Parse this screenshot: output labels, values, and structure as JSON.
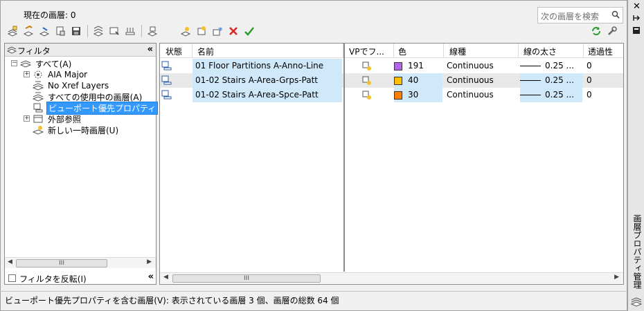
{
  "current_layer_label": "現在の画層: 0",
  "search": {
    "placeholder": "次の画層を検索"
  },
  "filter_panel": {
    "header": "フィルタ",
    "tree": [
      {
        "label": "すべて(A)"
      },
      {
        "label": "AIA Major"
      },
      {
        "label": "No Xref Layers"
      },
      {
        "label": "すべての使用中の画層(A)"
      },
      {
        "label": "ビューポート優先プロパティ"
      },
      {
        "label": "外部参照"
      },
      {
        "label": "新しい一時画層(U)"
      }
    ],
    "invert_filter": "フィルタを反転(I)",
    "collapse": "«",
    "scroll_thumb": "III"
  },
  "columns": {
    "status": "状態",
    "name": "名前",
    "vp_freeze": "VPでフ...",
    "color": "色",
    "linetype": "線種",
    "lineweight": "線の太さ",
    "transparency": "透過性"
  },
  "layers": [
    {
      "name": "01 Floor Partitions A-Anno-Line",
      "color_value": "191",
      "color_hex": "#b266e8",
      "linetype": "Continuous",
      "lineweight": "0.25 ...",
      "transparency": "0"
    },
    {
      "name": "01-02 Stairs A-Area-Grps-Patt",
      "color_value": "40",
      "color_hex": "#ffbf00",
      "linetype": "Continuous",
      "lineweight": "0.25 ...",
      "transparency": "0"
    },
    {
      "name": "01-02 Stairs A-Area-Spce-Patt",
      "color_value": "30",
      "color_hex": "#ff7f00",
      "linetype": "Continuous",
      "lineweight": "0.25 ...",
      "transparency": "0"
    }
  ],
  "grid_scroll_thumb": "III",
  "status_text": "ビューポート優先プロパティを含む画層(V): 表示されている画層 3 個、画層の総数 64 個",
  "palette_title": "画層プロパティ管理",
  "accent_color": "#3399ff",
  "name_highlight": "#cfe9fb"
}
